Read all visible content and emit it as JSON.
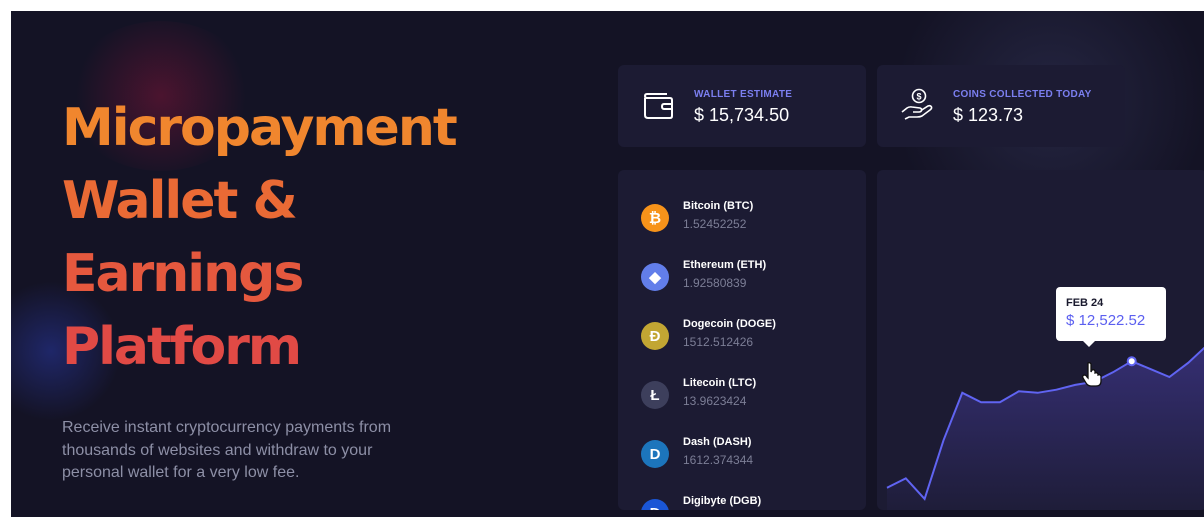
{
  "hero": {
    "headline": [
      "Micropayment",
      "Wallet &",
      "Earnings",
      "Platform"
    ],
    "subtitle_lines": [
      "Receive instant cryptocurrency payments from",
      "thousands of websites and withdraw to your",
      "personal wallet for a very low fee."
    ]
  },
  "stats": [
    {
      "label": "WALLET ESTIMATE",
      "value": "$ 15,734.50",
      "icon": "wallet-icon"
    },
    {
      "label": "COINS COLLECTED TODAY",
      "value": "$ 123.73",
      "icon": "coin-hand-icon"
    }
  ],
  "coins": [
    {
      "name": "Bitcoin (BTC)",
      "amount": "1.52452252",
      "icon": "bitcoin-icon",
      "symbol": "₿",
      "color": "#f7931a"
    },
    {
      "name": "Ethereum (ETH)",
      "amount": "1.92580839",
      "icon": "ethereum-icon",
      "symbol": "◆",
      "color": "#627eea"
    },
    {
      "name": "Dogecoin (DOGE)",
      "amount": "1512.512426",
      "icon": "dogecoin-icon",
      "symbol": "Ð",
      "color": "#c2a633"
    },
    {
      "name": "Litecoin (LTC)",
      "amount": "13.9623424",
      "icon": "litecoin-icon",
      "symbol": "Ł",
      "color": "#3d3f5c"
    },
    {
      "name": "Dash (DASH)",
      "amount": "1612.374344",
      "icon": "dash-icon",
      "symbol": "D",
      "color": "#1c75bc"
    },
    {
      "name": "Digibyte (DGB)",
      "amount": "",
      "icon": "digibyte-icon",
      "symbol": "Ɖ",
      "color": "#1a56d6"
    }
  ],
  "tooltip": {
    "date": "FEB 24",
    "value": "$ 12,522.52"
  },
  "colors": {
    "background": "#141325",
    "card": "#1c1b33",
    "accent": "#5b5ff0",
    "headline_gradient": [
      "#f0862e",
      "#e14a45"
    ]
  },
  "chart_data": {
    "type": "area",
    "series": [
      {
        "values": [
          0.14,
          0.2,
          0.07,
          0.44,
          0.74,
          0.68,
          0.68,
          0.75,
          0.74,
          0.76,
          0.79,
          0.81,
          0.87,
          0.94,
          0.89,
          0.84,
          0.93,
          1.04
        ]
      }
    ],
    "highlight": {
      "index": 13,
      "date": "FEB 24",
      "value": "$ 12,522.52"
    },
    "grid": false
  }
}
